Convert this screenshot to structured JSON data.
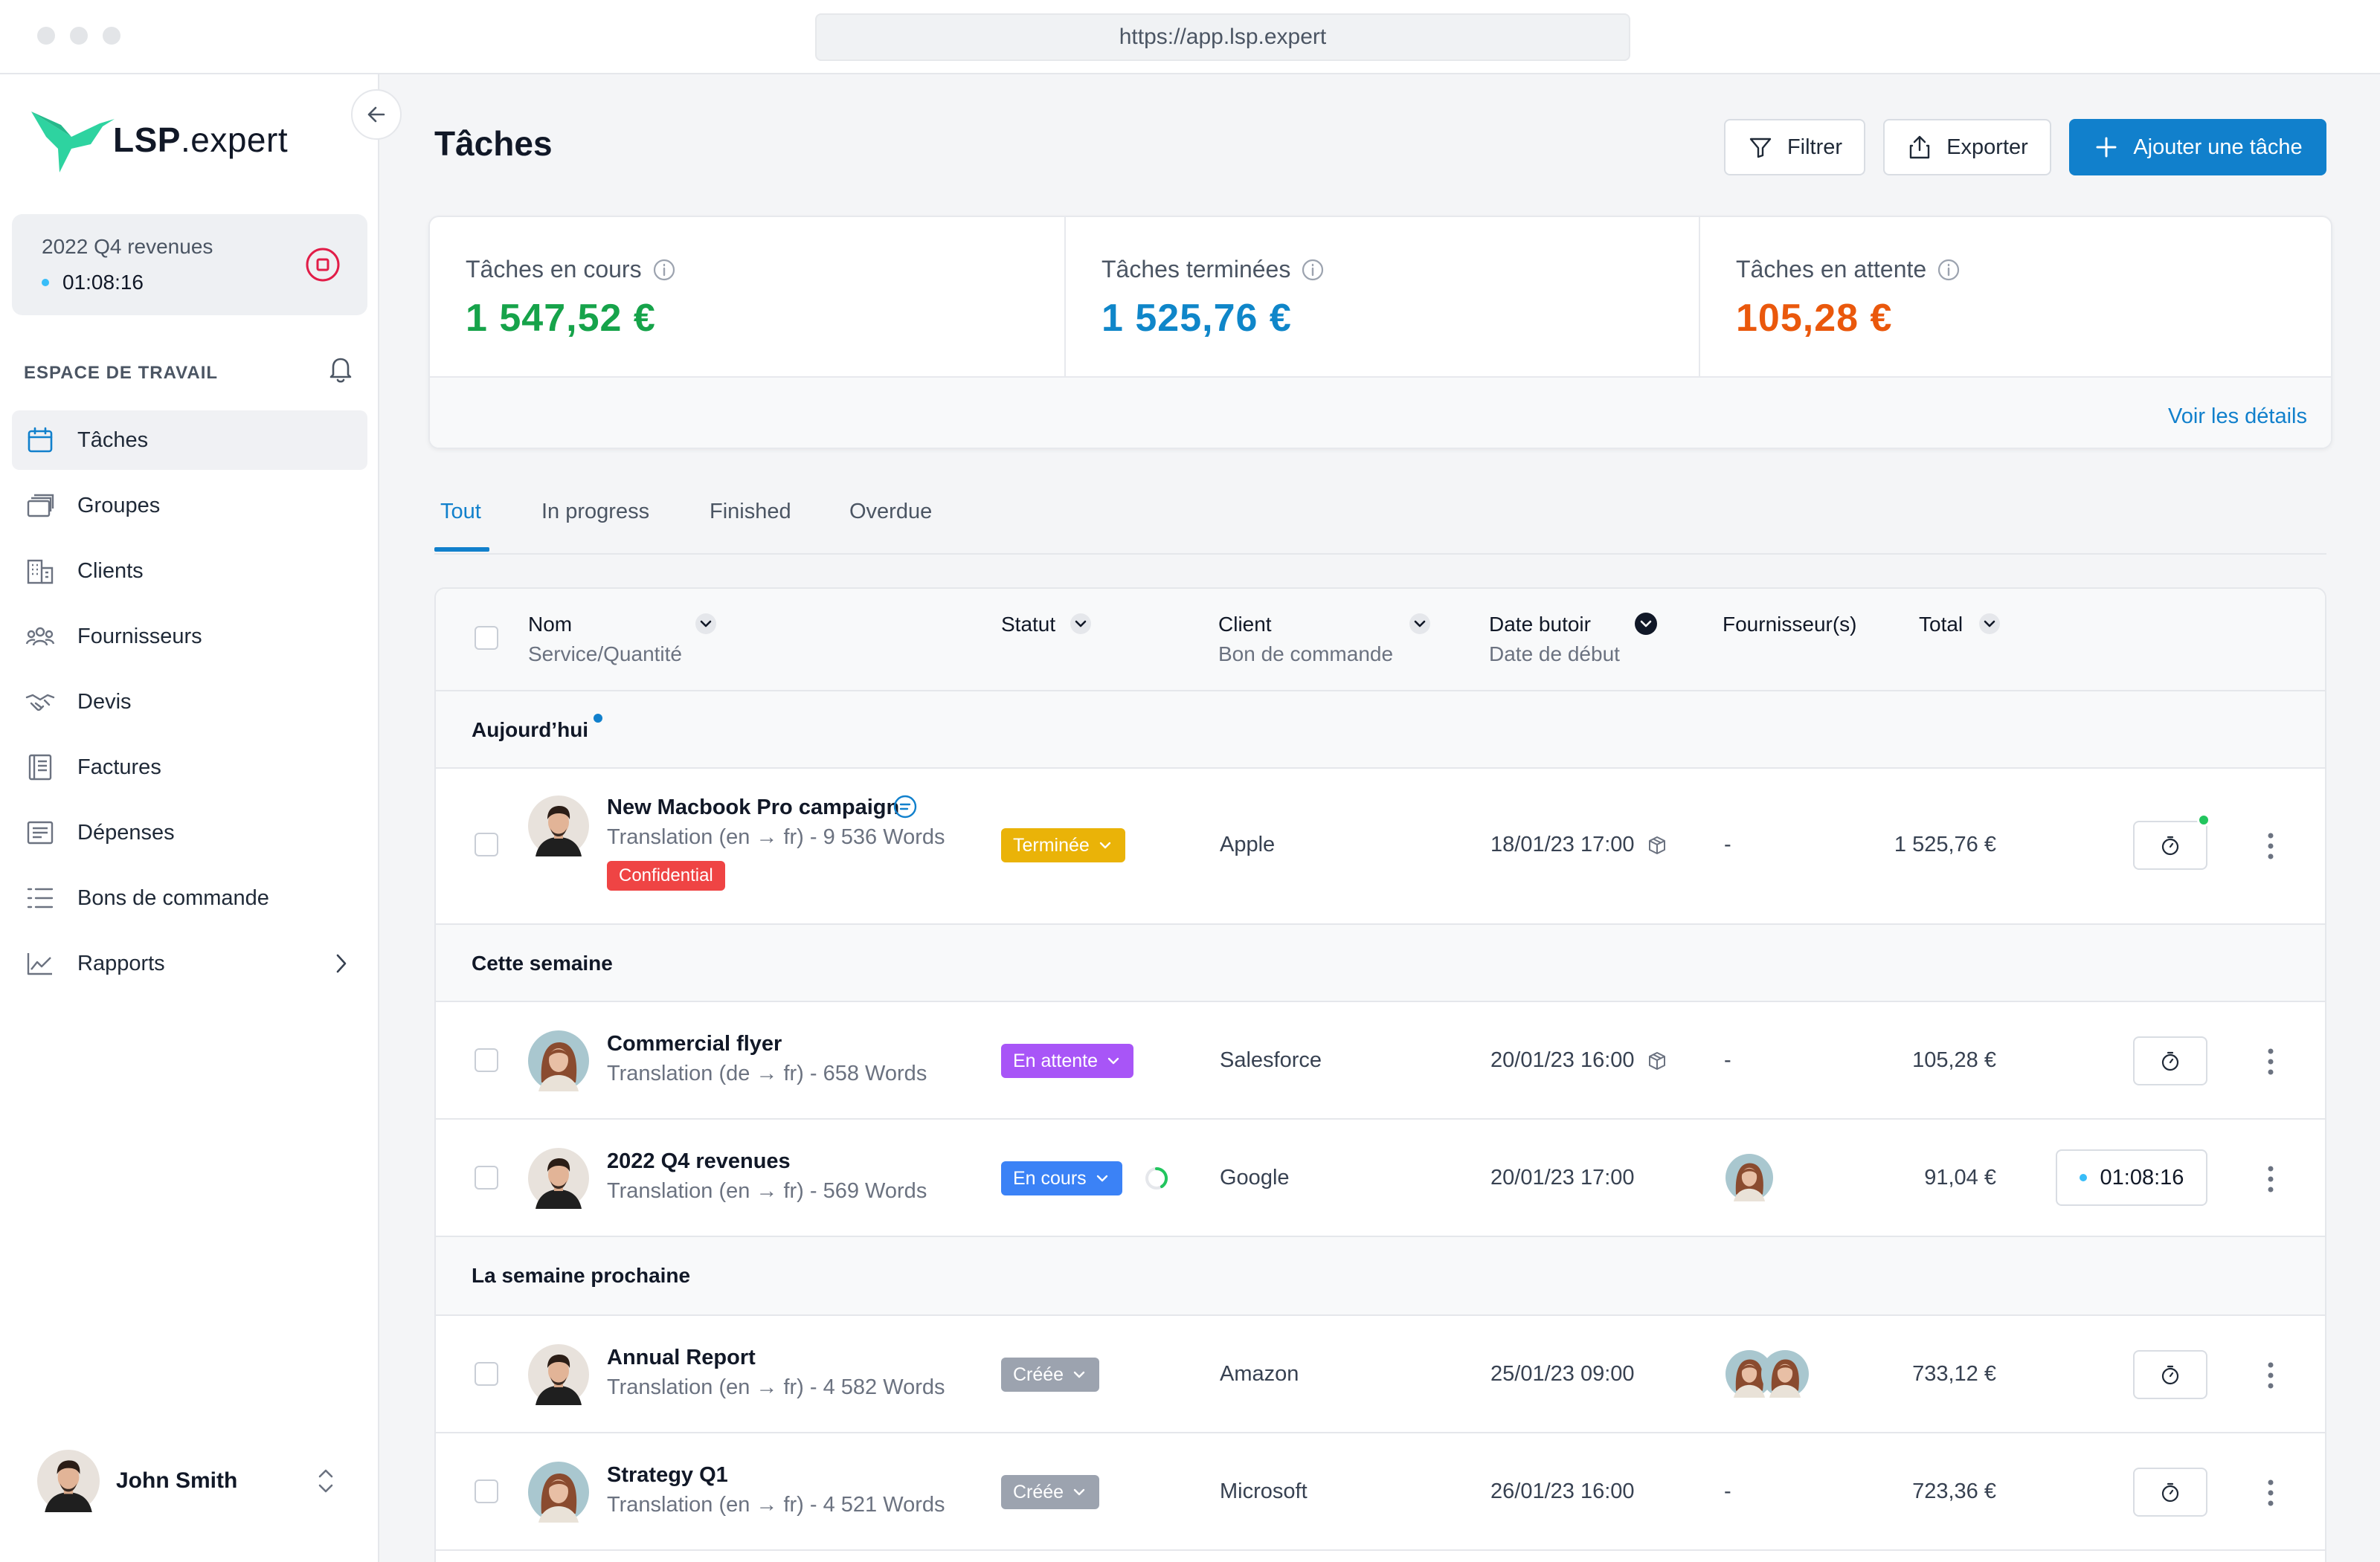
{
  "browser": {
    "url": "https://app.lsp.expert"
  },
  "brand": {
    "name_bold": "LSP",
    "name_rest": ".expert",
    "color": "#2ed3a0"
  },
  "timer": {
    "title": "2022 Q4 revenues",
    "elapsed": "01:08:16"
  },
  "sidebar": {
    "section_label": "ESPACE DE TRAVAIL",
    "items": [
      {
        "label": "Tâches",
        "icon": "calendar-icon",
        "active": true
      },
      {
        "label": "Groupes",
        "icon": "stack-icon"
      },
      {
        "label": "Clients",
        "icon": "building-icon"
      },
      {
        "label": "Fournisseurs",
        "icon": "people-icon"
      },
      {
        "label": "Devis",
        "icon": "handshake-icon"
      },
      {
        "label": "Factures",
        "icon": "invoice-icon"
      },
      {
        "label": "Dépenses",
        "icon": "receipt-icon"
      },
      {
        "label": "Bons de commande",
        "icon": "list-icon"
      },
      {
        "label": "Rapports",
        "icon": "chart-icon"
      }
    ],
    "user": {
      "name": "John Smith"
    }
  },
  "header": {
    "title": "Tâches",
    "filter_label": "Filtrer",
    "export_label": "Exporter",
    "add_label": "Ajouter une tâche"
  },
  "stats": {
    "in_progress": {
      "label": "Tâches en cours",
      "value": "1 547,52 €",
      "color": "#16a34a"
    },
    "finished": {
      "label": "Tâches terminées",
      "value": "1 525,76 €",
      "color": "#0f86c9"
    },
    "pending": {
      "label": "Tâches en attente",
      "value": "105,28 €",
      "color": "#ea580c"
    },
    "details_link": "Voir les détails"
  },
  "tabs": [
    "Tout",
    "In progress",
    "Finished",
    "Overdue"
  ],
  "table": {
    "columns": {
      "name": "Nom",
      "name_sub": "Service/Quantité",
      "status": "Statut",
      "client": "Client",
      "client_sub": "Bon de commande",
      "deadline": "Date butoir",
      "deadline_sub": "Date de début",
      "suppliers": "Fournisseur(s)",
      "total": "Total"
    },
    "groups": {
      "today": "Aujourd’hui",
      "this_week": "Cette semaine",
      "next_week": "La semaine prochaine"
    },
    "rows": [
      {
        "name": "New Macbook Pro campaign",
        "service": "Translation (en → fr) - 9 536 Words",
        "badge": "Confidential",
        "status": "Terminée",
        "status_color": "#eab308",
        "client": "Apple",
        "deadline": "18/01/23 17:00",
        "supplier": "-",
        "total": "1 525,76 €"
      },
      {
        "name": "Commercial flyer",
        "service": "Translation (de → fr) - 658 Words",
        "status": "En attente",
        "status_color": "#a855f7",
        "client": "Salesforce",
        "deadline": "20/01/23 16:00",
        "supplier": "-",
        "total": "105,28 €"
      },
      {
        "name": "2022 Q4 revenues",
        "service": "Translation (en → fr) - 569 Words",
        "status": "En cours",
        "status_color": "#3b82f6",
        "client": "Google",
        "deadline": "20/01/23 17:00",
        "total": "91,04 €",
        "timer": "01:08:16"
      },
      {
        "name": "Annual Report",
        "service": "Translation (en → fr) - 4 582 Words",
        "status": "Créée",
        "status_color": "#9ca3af",
        "client": "Amazon",
        "deadline": "25/01/23 09:00",
        "total": "733,12 €"
      },
      {
        "name": "Strategy Q1",
        "service": "Translation (en → fr) - 4 521 Words",
        "status": "Créée",
        "status_color": "#9ca3af",
        "client": "Microsoft",
        "deadline": "26/01/23 16:00",
        "supplier": "-",
        "total": "723,36 €"
      }
    ]
  }
}
